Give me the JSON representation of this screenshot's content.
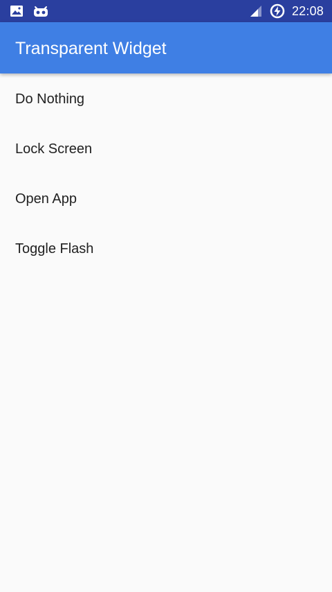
{
  "status_bar": {
    "time": "22:08",
    "icons_left": [
      "image-icon",
      "android-debug-icon"
    ],
    "icons_right": [
      "signal-icon",
      "battery-charging-icon"
    ],
    "background": "#2a3f9f"
  },
  "app_bar": {
    "title": "Transparent Widget",
    "background": "#3f7fe4"
  },
  "list": {
    "items": [
      {
        "label": "Do Nothing"
      },
      {
        "label": "Lock Screen"
      },
      {
        "label": "Open App"
      },
      {
        "label": "Toggle Flash"
      }
    ]
  }
}
